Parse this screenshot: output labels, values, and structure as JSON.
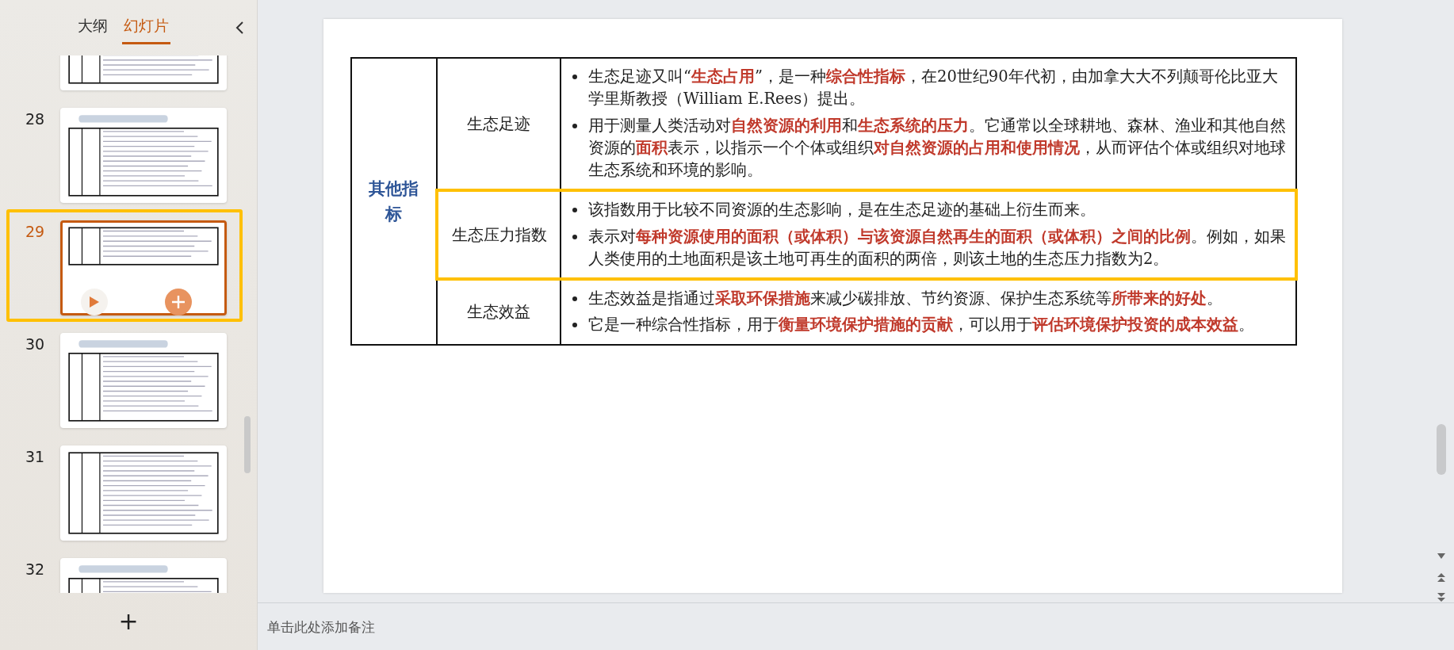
{
  "panel": {
    "tabs": [
      {
        "label": "大纲",
        "selected": false
      },
      {
        "label": "幻灯片",
        "selected": true
      }
    ],
    "thumbnails": [
      {
        "selected": false
      },
      {
        "number": "28",
        "selected": false
      },
      {
        "number": "29",
        "selected": true
      },
      {
        "number": "30",
        "selected": false
      },
      {
        "number": "31",
        "selected": false
      },
      {
        "number": "32",
        "selected": false
      }
    ],
    "add_label": "+"
  },
  "slide": {
    "table": {
      "category": "其他指标",
      "rows": [
        {
          "name": "生态足迹",
          "highlighted": false,
          "bullets": [
            "生态足迹又叫“**生态占用**”，是一种**综合性指标**，在20世纪90年代初，由加拿大大不列颠哥伦比亚大学里斯教授（William E.Rees）提出。",
            "用于测量人类活动对**自然资源的利用**和**生态系统的压力**。它通常以全球耕地、森林、渔业和其他自然资源的**面积**表示，以指示一个个体或组织**对自然资源的占用和使用情况**，从而评估个体或组织对地球生态系统和环境的影响。"
          ]
        },
        {
          "name": "生态压力指数",
          "highlighted": true,
          "bullets": [
            "该指数用于比较不同资源的生态影响，是在生态足迹的基础上衍生而来。",
            "表示对**每种资源使用的面积（或体积）与该资源自然再生的面积（或体积）之间的比例**。例如，如果人类使用的土地面积是该土地可再生的面积的两倍，则该土地的生态压力指数为2。"
          ]
        },
        {
          "name": "生态效益",
          "highlighted": false,
          "bullets": [
            "生态效益是指通过**采取环保措施**来减少碳排放、节约资源、保护生态系统等**所带来的好处**。",
            "它是一种综合性指标，用于**衡量环境保护措施的贡献**，可以用于**评估环境保护投资的成本效益**。"
          ]
        }
      ]
    }
  },
  "notes": {
    "hint_text": "单击此处添加备注"
  }
}
